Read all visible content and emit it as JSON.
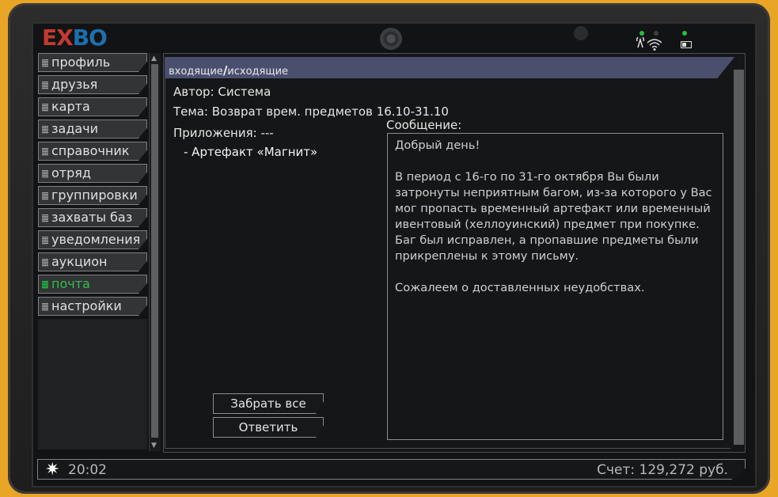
{
  "brand": {
    "logo_part1": "EX",
    "logo_part2": "BO"
  },
  "sidebar": {
    "items": [
      {
        "label": "профиль"
      },
      {
        "label": "друзья"
      },
      {
        "label": "карта"
      },
      {
        "label": "задачи"
      },
      {
        "label": "справочник"
      },
      {
        "label": "отряд"
      },
      {
        "label": "группировки"
      },
      {
        "label": "захваты баз"
      },
      {
        "label": "уведомления"
      },
      {
        "label": "аукцион"
      },
      {
        "label": "почта"
      },
      {
        "label": "настройки"
      }
    ],
    "active_index": 10,
    "active_color": "#2fc04c"
  },
  "tabs": {
    "inbox": "входящие",
    "separator": "/",
    "outbox": "исходящие"
  },
  "mail": {
    "author": "Автор: Система",
    "subject": "Тема: Возврат врем. предметов 16.10-31.10",
    "attachments_label": "Приложения: ---",
    "attachment_item": "- Артефакт «Магнит»",
    "message_label": "Сообщение:",
    "message_paragraphs": [
      "Добрый день!",
      "В период с 16-го по 31-го октября Вы были затронуты неприятным багом, из-за которого у Вас мог пропасть временный артефакт или временный ивентовый (хеллоуинский) предмет при покупке. Баг был исправлен, а пропавшие предметы были прикреплены к этому письму.",
      "Сожалеем о доставленных неудобствах."
    ]
  },
  "buttons": {
    "take_all": "Забрать все",
    "reply": "Ответить"
  },
  "status": {
    "time": "20:02",
    "balance": "Счет: 129,272 руб."
  },
  "icons": {
    "status_icon": "sun-icon",
    "signal": "wifi-icon",
    "battery": "battery-icon"
  },
  "colors": {
    "frame": "#e9a526",
    "tab_bar": "#4a4f6e",
    "led": "#22c03a"
  }
}
